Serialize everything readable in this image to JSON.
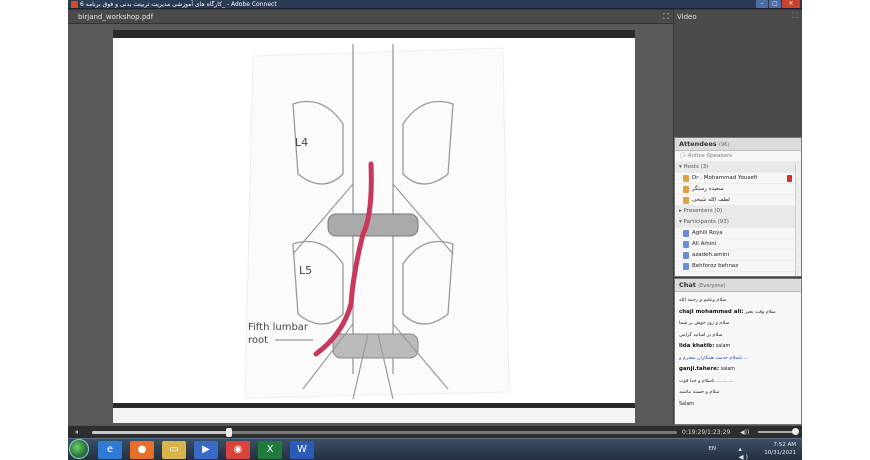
{
  "window": {
    "title": "کارگاه های آموزشی مدیریت تربیتت بدنی و فوق برنامه 6_ - Adobe Connect",
    "buttons": [
      "–",
      "▢",
      "✕"
    ]
  },
  "share_pod": {
    "filename": "birjand_workshop.pdf",
    "fullscreen_icon": "⛶",
    "figure_labels": {
      "l4": "L4",
      "l5": "L5",
      "root_line1": "Fifth lumbar",
      "root_line2": "root"
    }
  },
  "video_pod": {
    "title": "Video",
    "fullscreen_icon": "⛶"
  },
  "attendees": {
    "title": "Attendees",
    "count": "(96)",
    "active_speakers": "Active Speakers",
    "hosts_header": "Hosts (3)",
    "hosts": [
      "Dr . Mohammad Yousefi",
      "سعیده رستگر",
      "لطف الله شیخی"
    ],
    "presenters_header": "Presenters (0)",
    "participants_header": "Participants (93)",
    "participants": [
      "Aghili Roya",
      "Ali Amini",
      "azadeh.amini",
      "Behforoz behnaz"
    ]
  },
  "chat": {
    "title": "Chat",
    "scope": "(Everyone)",
    "messages": [
      {
        "sender": "",
        "text": "سلام وعلیم و رحمة الله"
      },
      {
        "sender": "chaji mohammad ali:",
        "text": "سلام وقت بخیر"
      },
      {
        "sender": "",
        "text": "سلام و روز خوش بر شما"
      },
      {
        "sender": "",
        "text": "سلام بر اساتید گرامی"
      },
      {
        "sender": "lida khatib:",
        "text": "salam"
      },
      {
        "sender": "",
        "text": "باسلام خدمت همکاران محترم و ..."
      },
      {
        "sender": "ganji.tahere:",
        "text": "salam"
      },
      {
        "sender": "",
        "text": "باسلام و خدا قوت  ...  ...  ..."
      },
      {
        "sender": "",
        "text": "سلام و خسته نباشید"
      },
      {
        "sender": "",
        "text": "Salam"
      }
    ]
  },
  "playback": {
    "play_icon": "⏸",
    "progress": 0.235,
    "time": "0:19:29/1:23:29",
    "volume_icon": "◀))",
    "volume_level": 1.0
  },
  "taskbar": {
    "apps": [
      {
        "icon": "ie-icon",
        "glyph": "e",
        "color": "#2f7ad4"
      },
      {
        "icon": "firefox-icon",
        "glyph": "●",
        "color": "#e6702a"
      },
      {
        "icon": "folder-icon",
        "glyph": "▭",
        "color": "#d9b44a"
      },
      {
        "icon": "media-player-icon",
        "glyph": "▶",
        "color": "#3a6ac8"
      },
      {
        "icon": "chrome-icon",
        "glyph": "◉",
        "color": "#d8443a"
      },
      {
        "icon": "excel-icon",
        "glyph": "X",
        "color": "#1f7a3c"
      },
      {
        "icon": "word-icon",
        "glyph": "W",
        "color": "#2b5ab8"
      }
    ],
    "language": "EN",
    "time": "7:52 AM",
    "date": "10/31/2021"
  }
}
